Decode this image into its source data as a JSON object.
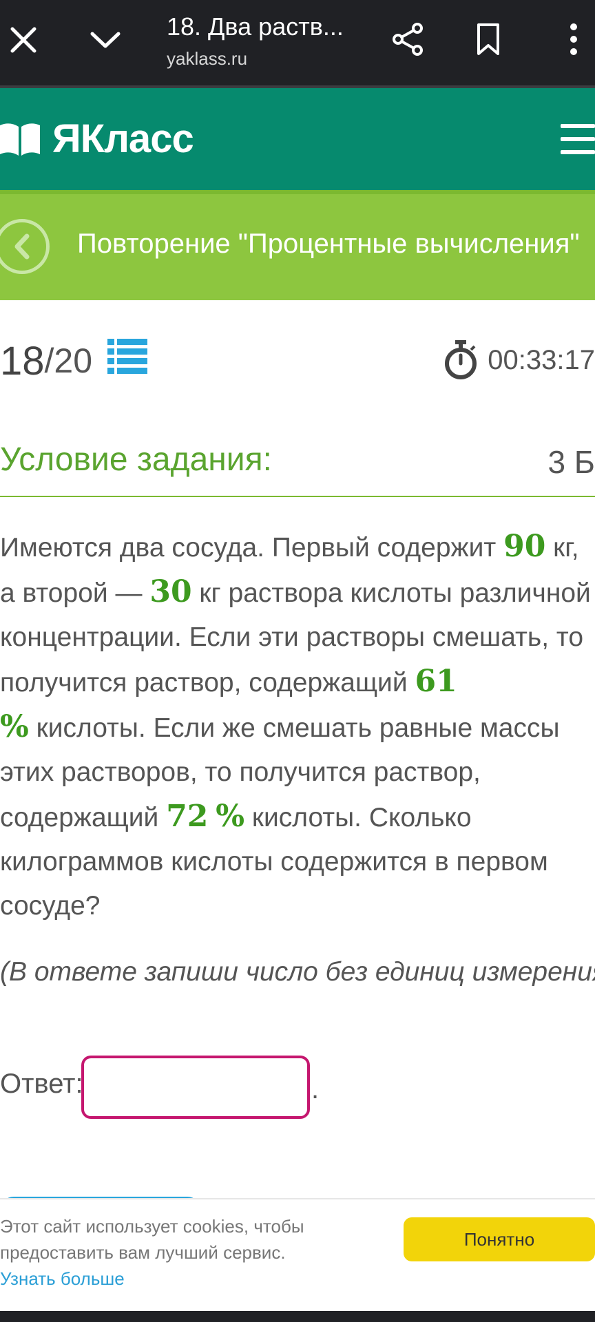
{
  "browser": {
    "title": "18. Два раств...",
    "url": "yaklass.ru"
  },
  "brand": {
    "name": "ЯКласс"
  },
  "topic": {
    "title": "Повторение \"Процентные вычисления\""
  },
  "progress": {
    "current": "18",
    "total": "/20",
    "timer": "00:33:17"
  },
  "condition": {
    "title": "Условие задания:",
    "points": "3 Б"
  },
  "problem": {
    "t1": "Имеются два сосуда. Первый содержит ",
    "n1": "90",
    "t2": " кг, а второй — ",
    "n2": "30",
    "t3": " кг раствора кислоты различной концентрации. Если эти растворы смешать, то получится раствор, содержащий ",
    "n3": "61",
    "p3": "%",
    "t4": " кислоты. Если же смешать равные массы этих растворов, то получится раствор, содержащий ",
    "n4": "72",
    "p4": "%",
    "t5": " кислоты. Сколько килограммов кислоты содержится в первом сосуде?"
  },
  "hint": "(В ответе запиши число без единиц измерения.)",
  "answer": {
    "label": "Ответ:",
    "value": "",
    "dot": "."
  },
  "cookie": {
    "text": "Этот сайт использует cookies, чтобы предоставить вам лучший сервис. ",
    "link": "Узнать больше",
    "button": "Понятно"
  },
  "colors": {
    "chrome_bg": "#202125",
    "brand_bg": "#068a6e",
    "topic_bg": "#8dc63f",
    "accent_green": "#5aa42f",
    "number_green": "#3d9a1f",
    "input_border": "#c5176f",
    "cookie_button": "#f2d40a",
    "link_blue": "#2c9fd6"
  },
  "icons": [
    "close-icon",
    "chevron-down-icon",
    "share-icon",
    "bookmark-icon",
    "more-vert-icon",
    "book-icon",
    "hamburger-icon",
    "back-icon",
    "list-icon",
    "stopwatch-icon"
  ]
}
